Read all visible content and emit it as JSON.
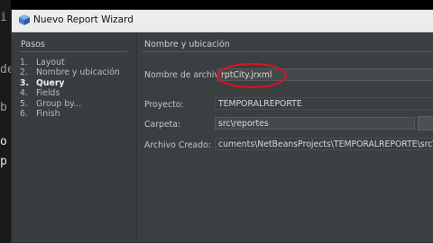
{
  "window": {
    "title": "Nuevo  Report Wizard"
  },
  "steps_panel": {
    "heading": "Pasos",
    "items": [
      {
        "num": "1.",
        "label": "Layout"
      },
      {
        "num": "2.",
        "label": "Nombre y ubicación"
      },
      {
        "num": "3.",
        "label": "Query",
        "current": true
      },
      {
        "num": "4.",
        "label": "Fields"
      },
      {
        "num": "5.",
        "label": "Group by..."
      },
      {
        "num": "6.",
        "label": "Finish"
      }
    ]
  },
  "main": {
    "heading": "Nombre y ubicación",
    "file_name": {
      "label": "Nombre de archivo:",
      "value": "rptCity.jrxml"
    },
    "project": {
      "label": "Proyecto:",
      "value": "TEMPORALREPORTE"
    },
    "folder": {
      "label": "Carpeta:",
      "value": "src\\reportes"
    },
    "created_file": {
      "label": "Archivo Creado:",
      "value": "cuments\\NetBeansProjects\\TEMPORALREPORTE\\src\\reportes\\rp"
    }
  },
  "editor_gutter": [
    "i",
    "de",
    "b",
    "o",
    "p"
  ],
  "colors": {
    "annotation": "#e3121c",
    "dialog_bg": "#3c3f41",
    "titlebar_bg": "#ececec"
  },
  "icons": {
    "app": "netbeans-cube-icon"
  }
}
